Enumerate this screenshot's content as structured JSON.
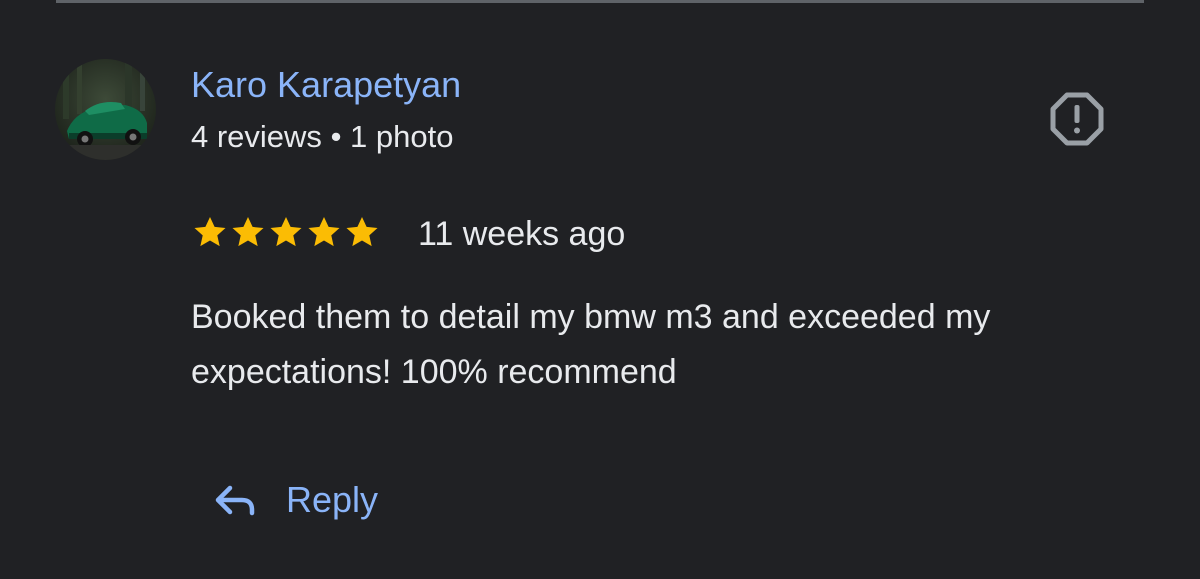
{
  "review": {
    "author": {
      "name": "Karo Karapetyan",
      "reviews_count": "4 reviews",
      "separator": "•",
      "photos_count": "1 photo",
      "avatar": "car-photo-avatar"
    },
    "rating": {
      "stars": 5,
      "max": 5
    },
    "time": "11 weeks ago",
    "text_line1": "Booked them to detail my bmw m3 and exceeded my",
    "text_line2": "expectations! 100% recommend",
    "actions": {
      "reply_label": "Reply",
      "reply_icon": "reply-arrow-icon",
      "report_icon": "report-octagon-icon"
    }
  },
  "colors": {
    "background": "#202124",
    "link": "#8ab4f8",
    "text": "#e8eaed",
    "star": "#fbbc04",
    "icon_muted": "#9aa0a6",
    "divider": "#5f6368"
  }
}
